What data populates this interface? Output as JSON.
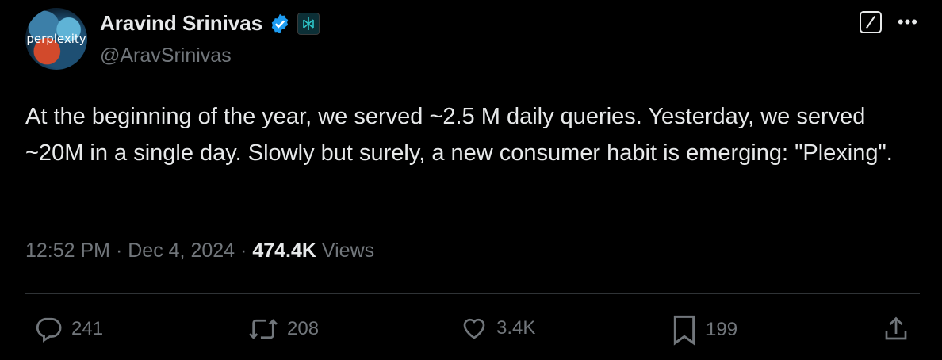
{
  "author": {
    "display_name": "Aravind Srinivas",
    "handle": "@AravSrinivas",
    "avatar_text": "perplexity",
    "verified": true,
    "affiliate_badge": "perplexity-logo"
  },
  "tweet": {
    "text": "At the beginning of the year, we served ~2.5 M daily queries. Yesterday, we served ~20M in a single day. Slowly but surely, a new consumer habit is emerging: \"Plexing\"."
  },
  "meta": {
    "time": "12:52 PM",
    "separator": "·",
    "date": "Dec 4, 2024",
    "views_count": "474.4K",
    "views_label": "Views"
  },
  "actions": {
    "replies": "241",
    "reposts": "208",
    "likes": "3.4K",
    "bookmarks": "199"
  },
  "colors": {
    "background": "#000000",
    "text": "#e7e9ea",
    "muted": "#71767b",
    "verified": "#1d9bf0",
    "divider": "#2f3336"
  },
  "icons": [
    "reply-icon",
    "repost-icon",
    "like-icon",
    "bookmark-icon",
    "share-icon",
    "grok-icon",
    "more-icon",
    "verified-badge-icon"
  ]
}
